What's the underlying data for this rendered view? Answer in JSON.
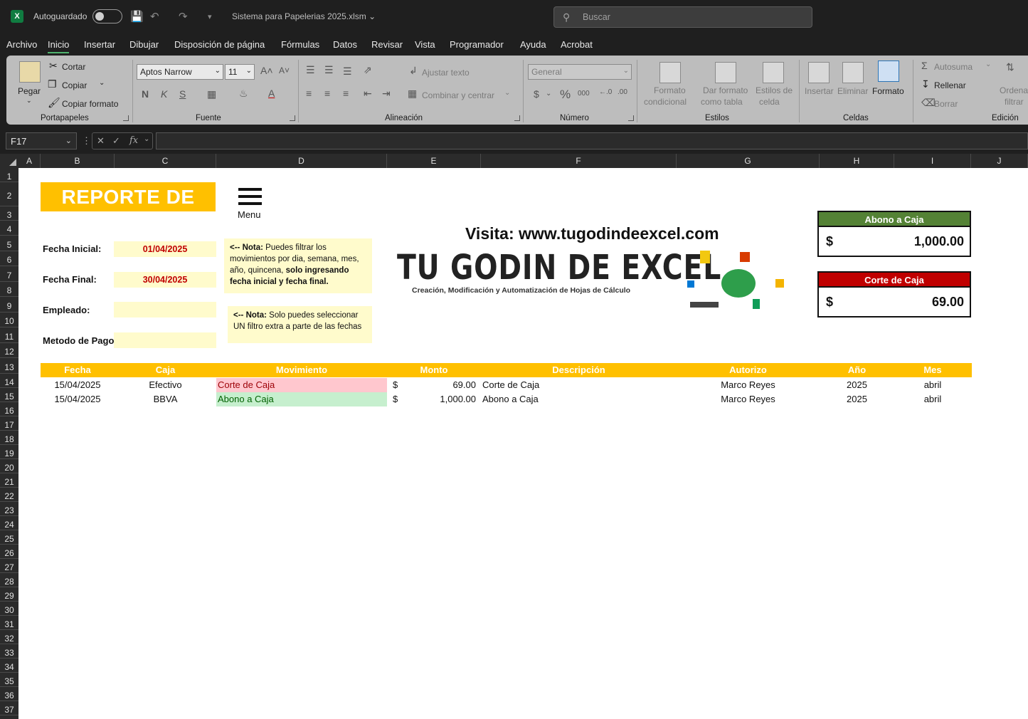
{
  "titlebar": {
    "autosave_label": "Autoguardado",
    "filename": "Sistema para Papelerias 2025.xlsm",
    "search_placeholder": "Buscar"
  },
  "menu_tabs": [
    "Archivo",
    "Inicio",
    "Insertar",
    "Dibujar",
    "Disposición de página",
    "Fórmulas",
    "Datos",
    "Revisar",
    "Vista",
    "Programador",
    "Ayuda",
    "Acrobat"
  ],
  "active_tab": "Inicio",
  "ribbon": {
    "portapapeles": {
      "paste": "Pegar",
      "cut": "Cortar",
      "copy": "Copiar",
      "format_painter": "Copiar formato",
      "label": "Portapapeles"
    },
    "fuente": {
      "font": "Aptos Narrow",
      "size": "11",
      "bold": "N",
      "italic": "K",
      "underline": "S",
      "label": "Fuente"
    },
    "alineacion": {
      "wrap": "Ajustar texto",
      "merge": "Combinar y centrar",
      "label": "Alineación"
    },
    "numero": {
      "format": "General",
      "currency": "$",
      "percent": "%",
      "thousands": "000",
      "label": "Número"
    },
    "estilos": {
      "cond1": "Formato",
      "cond2": "condicional",
      "table1": "Dar formato",
      "table2": "como tabla",
      "cell1": "Estilos de",
      "cell2": "celda",
      "label": "Estilos"
    },
    "celdas": {
      "insert": "Insertar",
      "delete": "Eliminar",
      "format": "Formato",
      "label": "Celdas"
    },
    "edicion": {
      "autosum": "Autosuma",
      "fill": "Rellenar",
      "clear": "Borrar",
      "sort1": "Ordena",
      "sort2": "filtrar",
      "label": "Edición"
    }
  },
  "formula_bar": {
    "cell_ref": "F17",
    "fx": "fx"
  },
  "columns": [
    "A",
    "B",
    "C",
    "D",
    "E",
    "F",
    "G",
    "H",
    "I",
    "J"
  ],
  "rows": [
    "1",
    "2",
    "3",
    "4",
    "5",
    "6",
    "7",
    "8",
    "9",
    "10",
    "11",
    "12",
    "13",
    "14",
    "15",
    "16",
    "17",
    "18",
    "19",
    "20",
    "21",
    "22",
    "23",
    "24",
    "25",
    "26",
    "27",
    "28",
    "29",
    "30",
    "31",
    "32",
    "33",
    "34",
    "35",
    "36",
    "37"
  ],
  "report": {
    "title": "REPORTE DE CAJA",
    "menu_label": "Menu",
    "fecha_inicial_label": "Fecha Inicial:",
    "fecha_inicial": "01/04/2025",
    "fecha_final_label": "Fecha Final:",
    "fecha_final": "30/04/2025",
    "empleado_label": "Empleado:",
    "metodo_label": "Metodo de Pago:",
    "note1_bold": "<-- Nota:",
    "note1_text": " Puedes filtrar los movimientos por dia, semana, mes, año, quincena, ",
    "note1_bold2": "solo ingresando fecha inicial y fecha final.",
    "note2_bold": "<-- Nota:",
    "note2_text": " Solo puedes seleccionar UN filtro extra a parte de las fechas",
    "visita": "Visita: www.tugodindeexcel.com",
    "logo_title": "TU GODIN DE EXCEL",
    "logo_subtitle": "Creación, Modificación y Automatización de Hojas de Cálculo"
  },
  "cards": {
    "abono": {
      "title": "Abono a Caja",
      "currency": "$",
      "amount": "1,000.00",
      "color": "#548235"
    },
    "corte": {
      "title": "Corte de Caja",
      "currency": "$",
      "amount": "69.00",
      "color": "#c00000"
    }
  },
  "table": {
    "headers": [
      "Fecha",
      "Caja",
      "Movimiento",
      "Monto",
      "Descripción",
      "Autorizo",
      "Año",
      "Mes"
    ],
    "rows": [
      {
        "fecha": "15/04/2025",
        "caja": "Efectivo",
        "movimiento": "Corte de Caja",
        "currency": "$",
        "monto": "69.00",
        "descripcion": "Corte de Caja",
        "autorizo": "Marco Reyes",
        "anio": "2025",
        "mes": "abril"
      },
      {
        "fecha": "15/04/2025",
        "caja": "BBVA",
        "movimiento": "Abono a Caja",
        "currency": "$",
        "monto": "1,000.00",
        "descripcion": "Abono a Caja",
        "autorizo": "Marco Reyes",
        "anio": "2025",
        "mes": "abril"
      }
    ]
  }
}
